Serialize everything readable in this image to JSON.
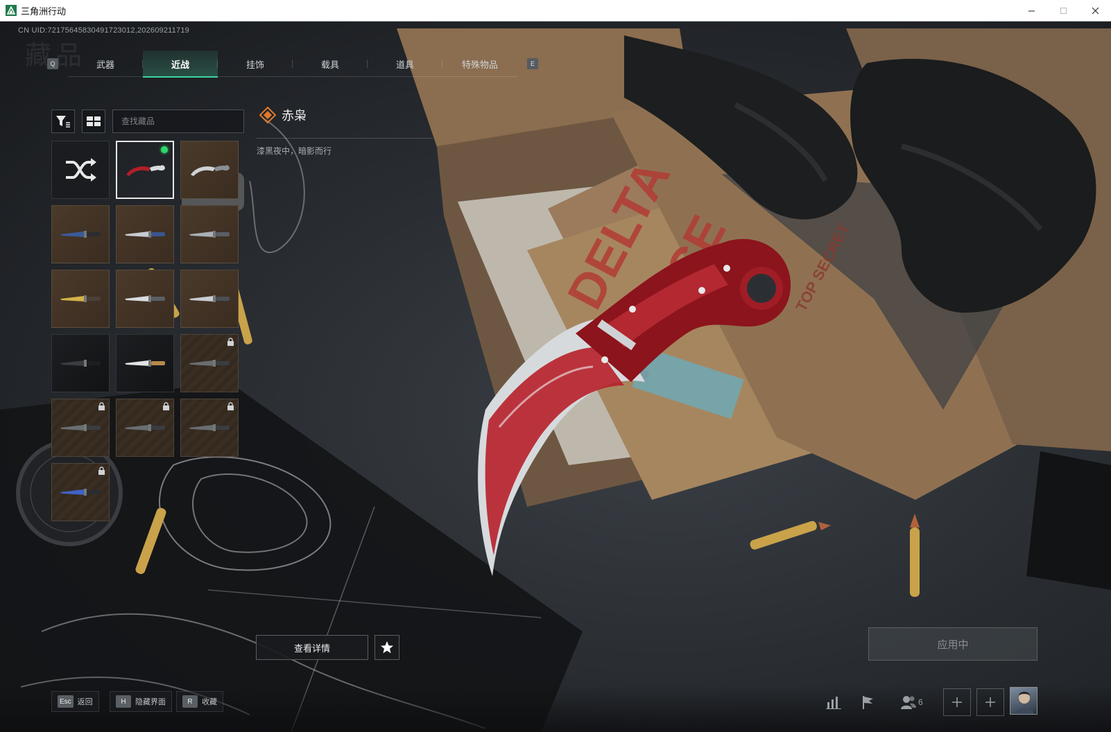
{
  "window": {
    "title": "三角洲行动"
  },
  "uid": "CN UID:72175645830491723012,202609211719",
  "ghost_title": "藏品",
  "tabs": {
    "left_key": "Q",
    "right_key": "E",
    "items": [
      {
        "label": "武器"
      },
      {
        "label": "近战"
      },
      {
        "label": "挂饰"
      },
      {
        "label": "载具"
      },
      {
        "label": "道具"
      },
      {
        "label": "特殊物品"
      }
    ],
    "active_index": 1
  },
  "search": {
    "placeholder": "查找藏品"
  },
  "detail": {
    "name": "赤枭",
    "description": "漆黑夜中，暗影而行",
    "view_details_label": "查看详情",
    "apply_label": "应用中"
  },
  "bottom_hints": [
    {
      "key": "Esc",
      "label": "返回"
    },
    {
      "key": "H",
      "label": "隐藏界面"
    },
    {
      "key": "R",
      "label": "收藏"
    }
  ],
  "friends_count": "6",
  "colors": {
    "accent": "#3fd4a0",
    "equipped": "#2fd66a",
    "blade_red": "#c0262b"
  },
  "grid_items": [
    {
      "kind": "random",
      "icon": "shuffle-icon"
    },
    {
      "kind": "selected",
      "icon": "karambit-red-icon",
      "equipped": true
    },
    {
      "kind": "brown",
      "icon": "karambit-silver-icon"
    },
    {
      "kind": "brown",
      "icon": "tomahawk-icon"
    },
    {
      "kind": "brown",
      "icon": "combat-knife-icon"
    },
    {
      "kind": "brown",
      "icon": "tactical-knife-icon"
    },
    {
      "kind": "brown",
      "icon": "gold-knife-icon"
    },
    {
      "kind": "brown",
      "icon": "serrated-knife-icon"
    },
    {
      "kind": "brown",
      "icon": "bowie-knife-icon"
    },
    {
      "kind": "dark",
      "icon": "black-knife-icon"
    },
    {
      "kind": "dark",
      "icon": "silver-knife-icon"
    },
    {
      "kind": "locked",
      "icon": "knife-icon",
      "locked": true
    },
    {
      "kind": "locked",
      "icon": "knife-icon",
      "locked": true
    },
    {
      "kind": "locked",
      "icon": "knife-icon",
      "locked": true
    },
    {
      "kind": "locked",
      "icon": "knife-icon",
      "locked": true
    },
    {
      "kind": "locked",
      "icon": "blue-knife-icon",
      "locked": true
    }
  ]
}
